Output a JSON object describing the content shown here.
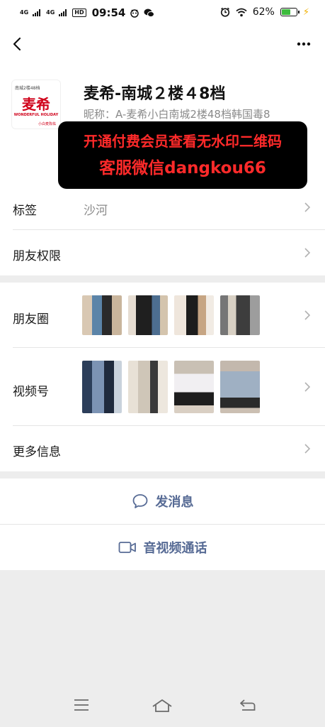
{
  "status_bar": {
    "signal1": "4G",
    "signal2": "4G",
    "hd": "HD",
    "time": "09:54",
    "battery_pct": "62%",
    "battery_level": 0.62
  },
  "profile": {
    "avatar_top_text": "南城2楼48档",
    "avatar_brand": "麦希",
    "avatar_sub": "WONDERFUL HOLIDAY",
    "avatar_foot": "小白麦陈佑",
    "display_name": "麦希-南城２楼４8档",
    "nickname": "昵称：A-麦希小白南城2楼48档韩国毒8"
  },
  "watermark": {
    "line1": "开通付费会员查看无水印二维码",
    "line2": "客服微信dangkou66"
  },
  "rows": {
    "tags_label": "标签",
    "tags_value": "沙河",
    "friend_permission_label": "朋友权限",
    "moments_label": "朋友圈",
    "channels_label": "视频号",
    "more_info_label": "更多信息"
  },
  "actions": {
    "send_message": "发消息",
    "video_call": "音视频通话"
  },
  "colors": {
    "link_blue": "#576b95",
    "watermark_red": "#ff2a2a",
    "background": "#ededed"
  }
}
